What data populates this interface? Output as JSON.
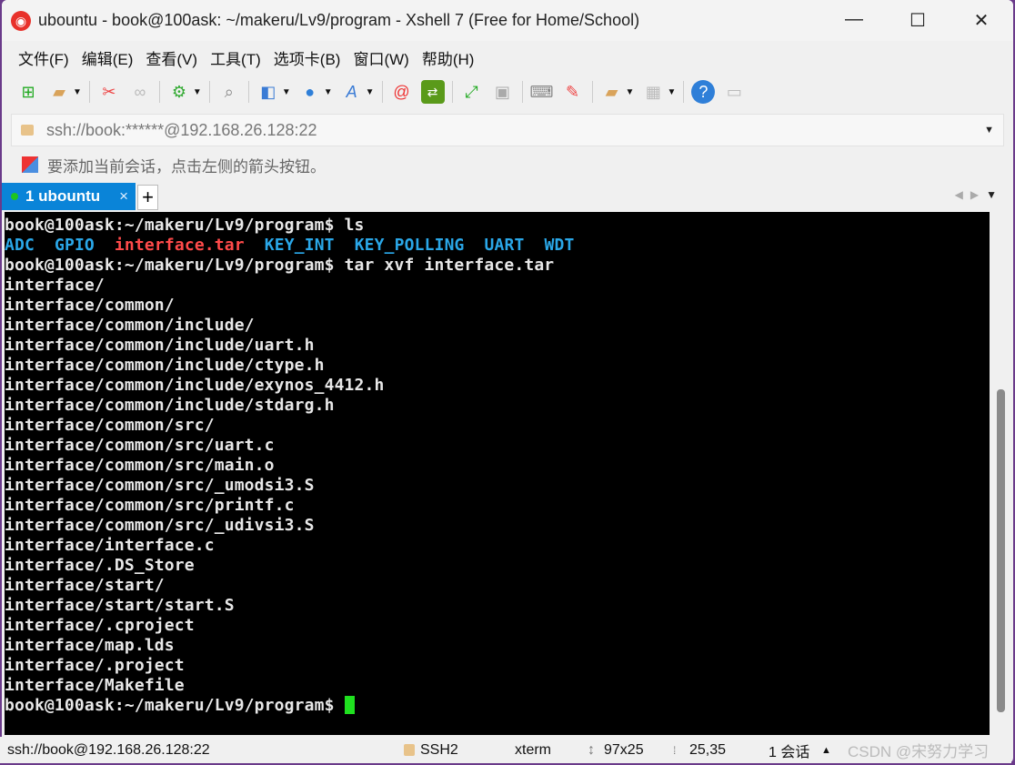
{
  "title": "ubountu - book@100ask: ~/makeru/Lv9/program - Xshell 7 (Free for Home/School)",
  "window_controls": {
    "minimize": "—",
    "maximize": "☐",
    "close": "✕"
  },
  "menu": [
    "文件(F)",
    "编辑(E)",
    "查看(V)",
    "工具(T)",
    "选项卡(B)",
    "窗口(W)",
    "帮助(H)"
  ],
  "address": "ssh://book:******@192.168.26.128:22",
  "hint": "要添加当前会话，点击左侧的箭头按钮。",
  "tab": {
    "label": "1 ubountu",
    "close": "×",
    "new": "+"
  },
  "terminal": {
    "prompt": "book@100ask:~/makeru/Lv9/program$ ",
    "cmd1": "ls",
    "ls": [
      {
        "t": "ADC",
        "k": "dir"
      },
      {
        "t": "GPIO",
        "k": "dir"
      },
      {
        "t": "interface.tar",
        "k": "arc"
      },
      {
        "t": "KEY_INT",
        "k": "dir"
      },
      {
        "t": "KEY_POLLING",
        "k": "dir"
      },
      {
        "t": "UART",
        "k": "dir"
      },
      {
        "t": "WDT",
        "k": "dir"
      }
    ],
    "cmd2": "tar xvf interface.tar",
    "output": [
      "interface/",
      "interface/common/",
      "interface/common/include/",
      "interface/common/include/uart.h",
      "interface/common/include/ctype.h",
      "interface/common/include/exynos_4412.h",
      "interface/common/include/stdarg.h",
      "interface/common/src/",
      "interface/common/src/uart.c",
      "interface/common/src/main.o",
      "interface/common/src/_umodsi3.S",
      "interface/common/src/printf.c",
      "interface/common/src/_udivsi3.S",
      "interface/interface.c",
      "interface/.DS_Store",
      "interface/start/",
      "interface/start/start.S",
      "interface/.cproject",
      "interface/map.lds",
      "interface/.project",
      "interface/Makefile"
    ]
  },
  "status": {
    "connection": "ssh://book@192.168.26.128:22",
    "protocol": "SSH2",
    "term": "xterm",
    "size": "97x25",
    "cursor": "25,35",
    "sessions": "1 会话",
    "watermark": "CSDN @宋努力学习"
  }
}
